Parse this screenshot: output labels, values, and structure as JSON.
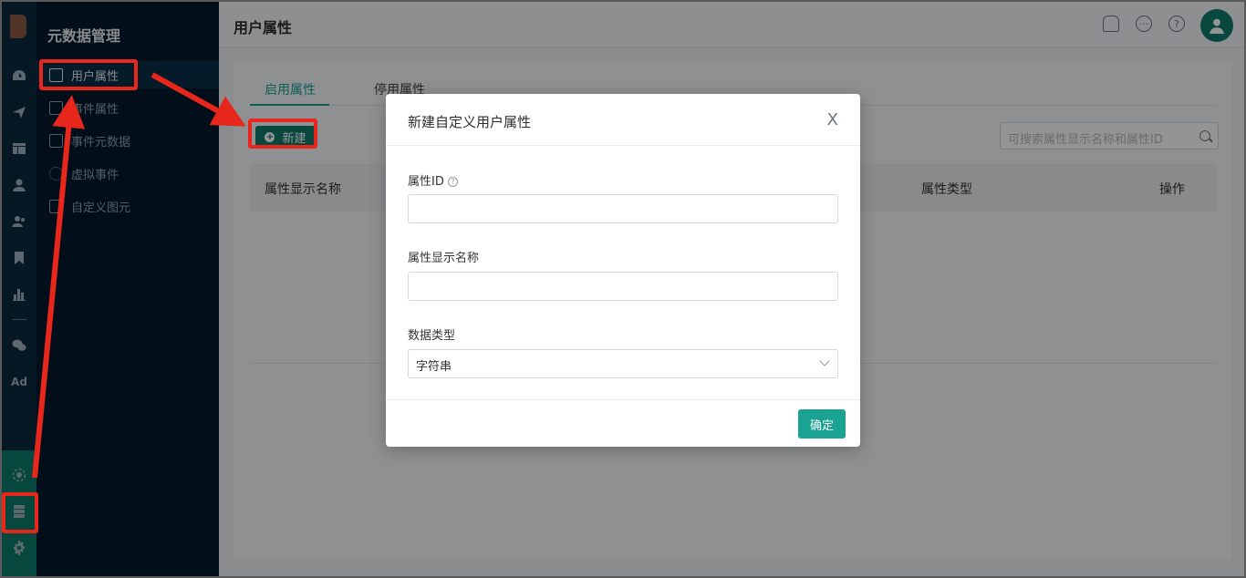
{
  "rail": {
    "icons": [
      "dashboard-icon",
      "send-icon",
      "layout-icon",
      "user-icon",
      "users-icon",
      "bookmark-icon",
      "bar-chart-icon",
      "wechat-icon"
    ],
    "ad_label": "Ad",
    "bottom_icons": [
      "hub-icon",
      "metadata-icon",
      "gear-icon"
    ]
  },
  "subnav": {
    "title": "元数据管理",
    "items": [
      {
        "label": "用户属性",
        "icon": "user-attribute-icon"
      },
      {
        "label": "事件属性",
        "icon": "event-attribute-icon"
      },
      {
        "label": "事件元数据",
        "icon": "event-metadata-icon"
      },
      {
        "label": "虚拟事件",
        "icon": "virtual-event-icon"
      },
      {
        "label": "自定义图元",
        "icon": "custom-element-icon"
      }
    ]
  },
  "header": {
    "title": "用户属性",
    "icons": [
      "bell-icon",
      "message-icon",
      "help-icon",
      "avatar-icon"
    ]
  },
  "tabs": [
    "启用属性",
    "停用属性"
  ],
  "toolbar": {
    "new_label": "新建",
    "search_placeholder": "可搜索属性显示名称和属性ID"
  },
  "table": {
    "columns": [
      "属性显示名称",
      "属性类型",
      "操作"
    ]
  },
  "modal": {
    "title": "新建自定义用户属性",
    "close": "X",
    "field_id_label": "属性ID",
    "field_id_help": "?",
    "field_name_label": "属性显示名称",
    "field_type_label": "数据类型",
    "field_type_value": "字符串",
    "confirm_label": "确定"
  },
  "colors": {
    "accent": "#1aa394",
    "primary_dark": "#0f7c6b",
    "annotation_red": "#e8271c",
    "sidebar_bg": "#041b2f"
  }
}
